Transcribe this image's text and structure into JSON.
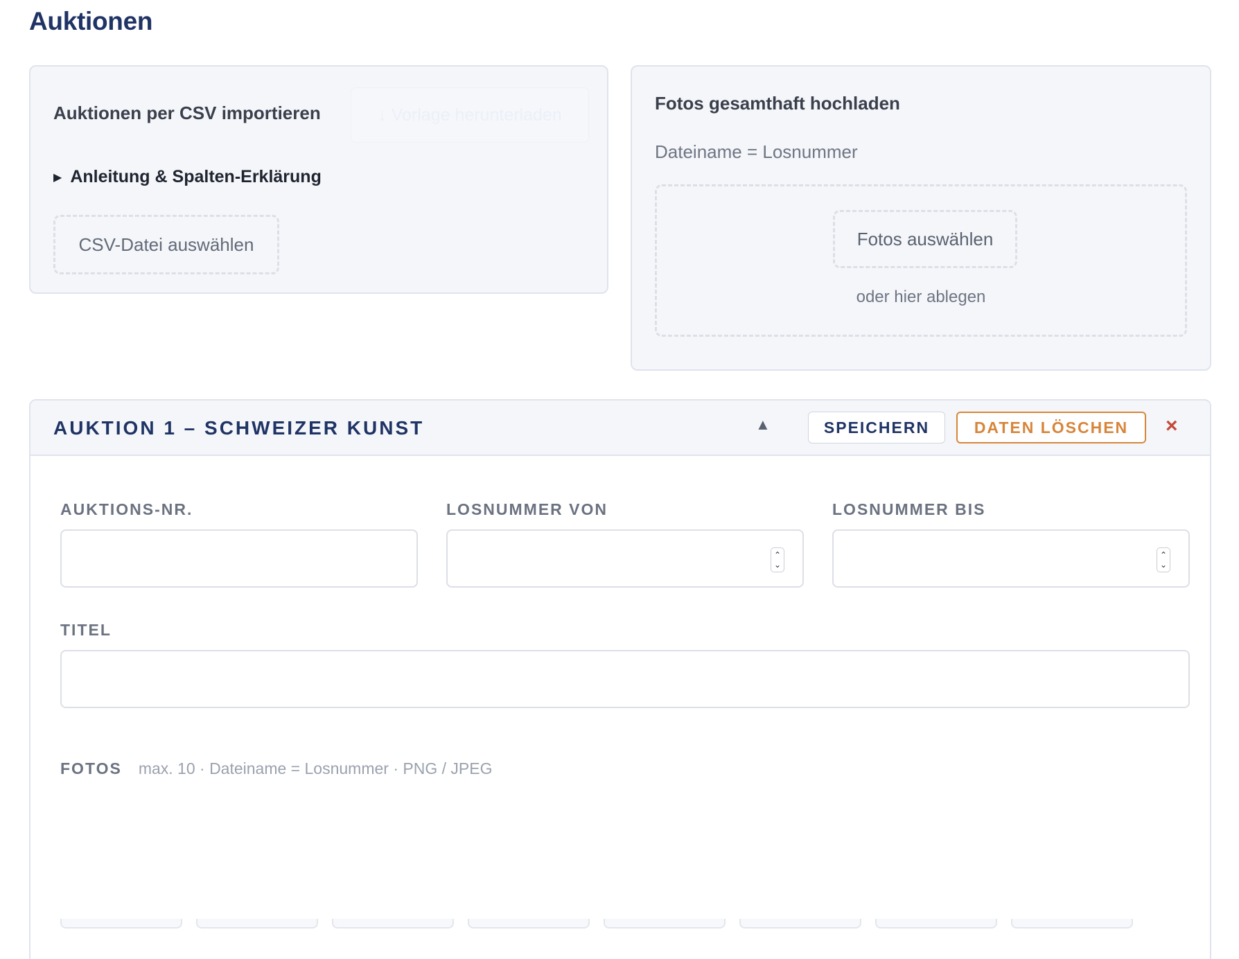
{
  "page": {
    "title": "Auktionen"
  },
  "csv_import": {
    "title": "Auktionen per CSV importieren",
    "template_button": "↓ Vorlage herunterladen",
    "details_label": "Anleitung & Spalten-Erklärung",
    "choose_button": "CSV-Datei auswählen"
  },
  "photo_upload": {
    "title": "Fotos gesamthaft hochladen",
    "hint": "Dateiname = Losnummer",
    "choose_button": "Fotos auswählen",
    "drop_text": "oder hier ablegen"
  },
  "auction": {
    "title": "AUKTION 1 – SCHWEIZER KUNST",
    "collapse_icon": "▲",
    "save_label": "SPEICHERN",
    "delete_label": "DATEN LÖSCHEN",
    "close_icon": "×",
    "fields": {
      "auction_no": {
        "label": "AUKTIONS-NR.",
        "value": ""
      },
      "lot_from": {
        "label": "LOSNUMMER VON",
        "value": ""
      },
      "lot_to": {
        "label": "LOSNUMMER BIS",
        "value": ""
      },
      "title": {
        "label": "TITEL",
        "value": ""
      }
    },
    "photos": {
      "label": "FOTOS",
      "hint": "max. 10 · Dateiname = Losnummer · PNG / JPEG"
    }
  },
  "icons": {
    "details_toggle": "triangle-right-icon",
    "collapse": "chevron-up-icon",
    "close": "close-icon",
    "spinner": "number-spinner-icon"
  },
  "colors": {
    "primary": "#1f3364",
    "danger_orange": "#d7853a",
    "close_red": "#c44a3a",
    "panel_bg": "#f4f6fa"
  }
}
